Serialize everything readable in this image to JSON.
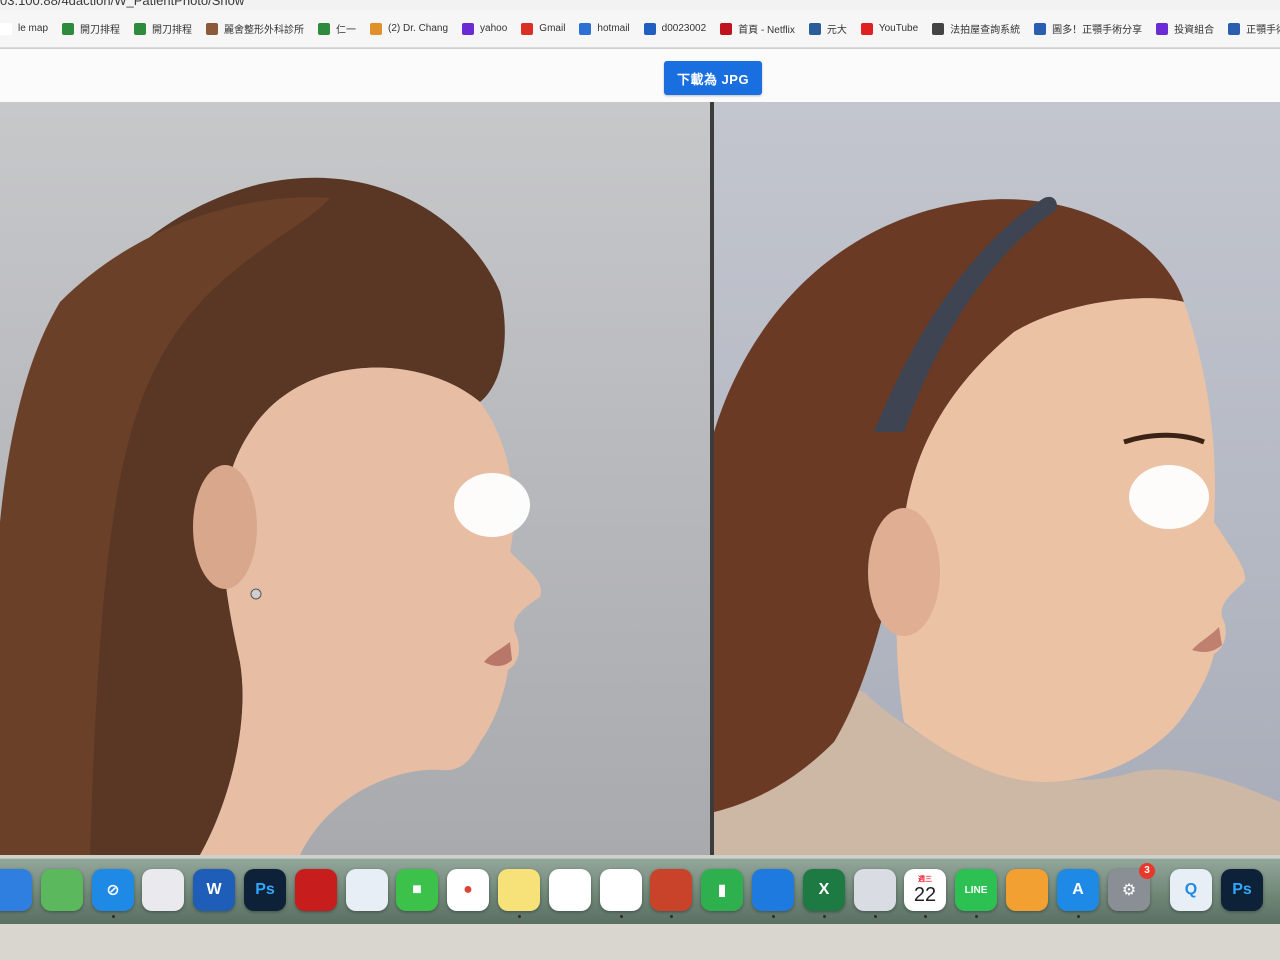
{
  "url_text": "03.100.88/4daction/W_PatientPhoto/Show",
  "bookmarks": [
    {
      "label": "le map",
      "icon": "map-icon",
      "color": "#ffffff"
    },
    {
      "label": "開刀排程",
      "icon": "folder-icon",
      "color": "#2e8b3e"
    },
    {
      "label": "開刀排程",
      "icon": "folder-icon",
      "color": "#2e8b3e"
    },
    {
      "label": "麗舍整形外科診所",
      "icon": "avatar-icon",
      "color": "#8a5a3a"
    },
    {
      "label": "仁一",
      "icon": "folder-icon",
      "color": "#2e8b3e"
    },
    {
      "label": "(2) Dr. Chang",
      "icon": "diamond-icon",
      "color": "#e0902a"
    },
    {
      "label": "yahoo",
      "icon": "slash-icon",
      "color": "#6a2bd4"
    },
    {
      "label": "Gmail",
      "icon": "gmail-icon",
      "color": "#d93025"
    },
    {
      "label": "hotmail",
      "icon": "mail-icon",
      "color": "#2d6fd6"
    },
    {
      "label": "d0023002",
      "icon": "outlook-icon",
      "color": "#1f5fbf"
    },
    {
      "label": "首頁 - Netflix",
      "icon": "netflix-icon",
      "color": "#c0121c"
    },
    {
      "label": "元大",
      "icon": "star-icon",
      "color": "#2a5c9a"
    },
    {
      "label": "YouTube",
      "icon": "youtube-icon",
      "color": "#e02020"
    },
    {
      "label": "法拍屋查詢系統",
      "icon": "globe-icon",
      "color": "#444444"
    },
    {
      "label": "圖多！正顎手術分享",
      "icon": "bookmark-icon",
      "color": "#2a5db0"
    },
    {
      "label": "投資組合",
      "icon": "slash-icon",
      "color": "#6a2bd4"
    },
    {
      "label": "正顎手術 Orthog",
      "icon": "circle-c-icon",
      "color": "#2a5db0"
    }
  ],
  "download_button": {
    "label": "下載為 JPG"
  },
  "photos": {
    "left": {
      "label": "patient-profile-photo-left"
    },
    "right": {
      "label": "patient-profile-photo-right"
    }
  },
  "dock": {
    "calendar_day": "22",
    "calendar_weekday": "週三",
    "settings_badge": "3",
    "photoshop_label": "Ps",
    "word_label": "W",
    "excel_label": "X",
    "line_label": "LINE",
    "apps": [
      {
        "icon": "finder-icon",
        "color": "#2f7fe0"
      },
      {
        "icon": "maps-icon",
        "color": "#5cb85c"
      },
      {
        "icon": "safari-icon",
        "color": "#1f8ae6"
      },
      {
        "icon": "launchpad-icon",
        "color": "#e9e9ee"
      },
      {
        "icon": "word-icon",
        "color": "#1e5eb8"
      },
      {
        "icon": "photoshop-icon",
        "color": "#0d2238"
      },
      {
        "icon": "acrobat-icon",
        "color": "#c81d1d"
      },
      {
        "icon": "appstore-like-icon",
        "color": "#e8eef5"
      },
      {
        "icon": "facetime-icon",
        "color": "#3cc24a"
      },
      {
        "icon": "chrome-icon",
        "color": "#ffffff"
      },
      {
        "icon": "notes-icon",
        "color": "#f7e27a"
      },
      {
        "icon": "photos-icon",
        "color": "#ffffff"
      },
      {
        "icon": "reminders-icon",
        "color": "#ffffff"
      },
      {
        "icon": "powerpoint-icon",
        "color": "#c8432a"
      },
      {
        "icon": "numbers-icon",
        "color": "#2fb04e"
      },
      {
        "icon": "keynote-icon",
        "color": "#1f7ae0"
      },
      {
        "icon": "excel-icon",
        "color": "#1d7a43"
      },
      {
        "icon": "webcam-icon",
        "color": "#d9dde3"
      },
      {
        "icon": "calendar-icon",
        "color": "#ffffff"
      },
      {
        "icon": "line-icon",
        "color": "#2cc152"
      },
      {
        "icon": "pages-icon",
        "color": "#f2a031"
      },
      {
        "icon": "app-store-icon",
        "color": "#1f8ae6"
      },
      {
        "icon": "system-settings-icon",
        "color": "#8a8f96"
      },
      {
        "icon": "quicktime-icon",
        "color": "#e8eef5"
      },
      {
        "icon": "photoshop-icon",
        "color": "#0d2238"
      }
    ]
  }
}
